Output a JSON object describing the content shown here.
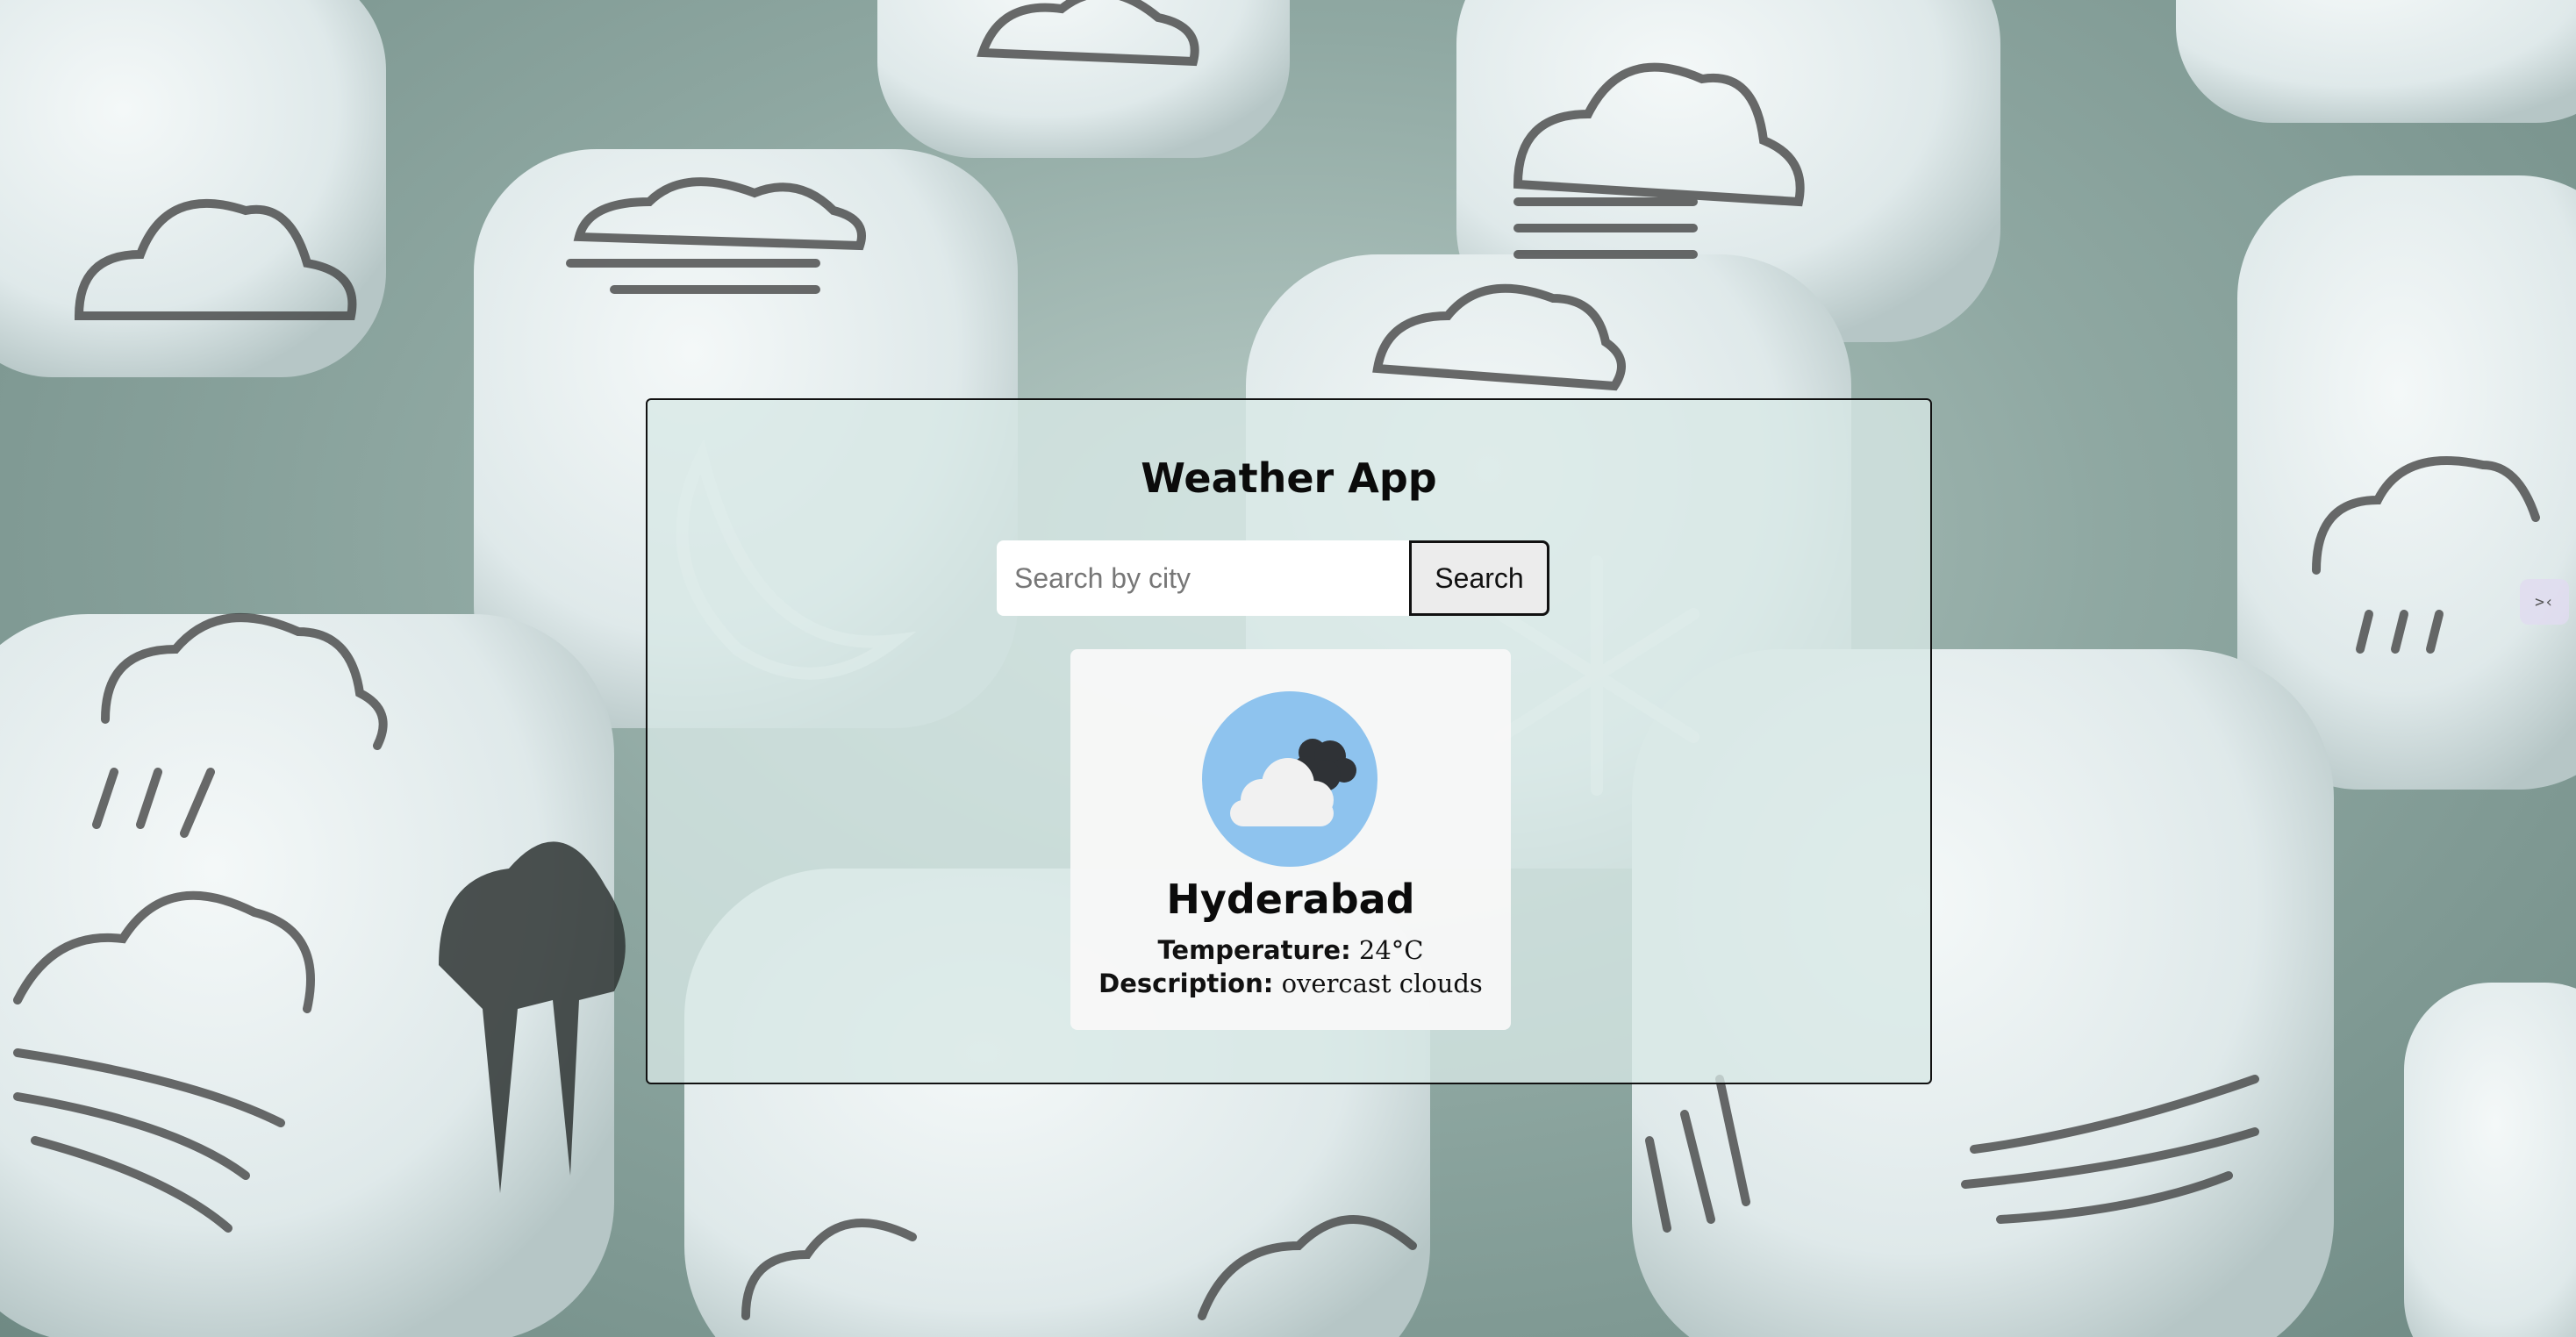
{
  "app": {
    "title": "Weather App"
  },
  "search": {
    "placeholder": "Search by city",
    "value": "",
    "button_label": "Search"
  },
  "weather": {
    "city": "Hyderabad",
    "temperature_label": "Temperature:",
    "temperature_value": "24°C",
    "description_label": "Description:",
    "description_value": "overcast clouds",
    "icon": "overcast-clouds-icon"
  },
  "side_handle": {
    "icon": "collapse-arrows-icon",
    "glyph": ">‹"
  },
  "colors": {
    "panel_bg": "#d7e8e5",
    "icon_circle": "#8ec3ee",
    "card_bg": "#f8f8f8",
    "border": "#111111"
  }
}
